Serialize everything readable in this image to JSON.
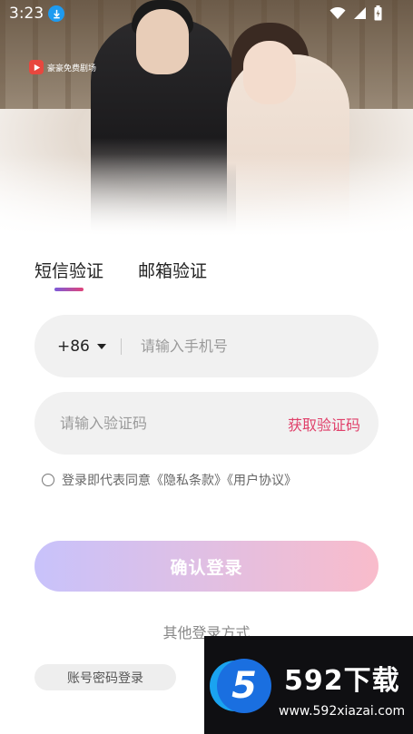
{
  "status_bar": {
    "time": "3:23"
  },
  "hero": {
    "brand_text": "豪豪免费剧场"
  },
  "tabs": [
    {
      "label": "短信验证",
      "active": true
    },
    {
      "label": "邮箱验证",
      "active": false
    }
  ],
  "phone": {
    "country_code": "+86",
    "placeholder": "请输入手机号",
    "value": ""
  },
  "code": {
    "placeholder": "请输入验证码",
    "value": "",
    "get_code_label": "获取验证码"
  },
  "agreement": {
    "text": "登录即代表同意《隐私条款》《用户协议》",
    "checked": false
  },
  "login_button": {
    "label": "确认登录"
  },
  "other_methods": {
    "label": "其他登录方式"
  },
  "account_login": {
    "label": "账号密码登录"
  },
  "watermark": {
    "title": "592下载",
    "url": "www.592xiazai.com",
    "badge": "5"
  },
  "colors": {
    "accent": "#e0406a",
    "tab_indicator_start": "#7d5bd9",
    "tab_indicator_end": "#e0447a",
    "button_start": "#c8c2fb",
    "button_end": "#f9bccb"
  }
}
